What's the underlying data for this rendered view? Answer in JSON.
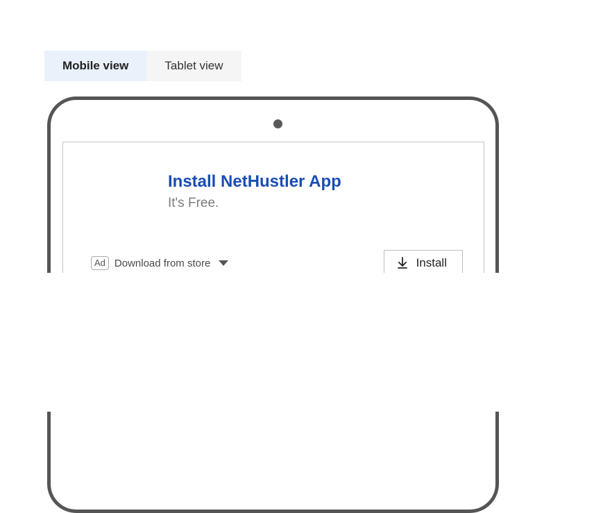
{
  "tabs": {
    "mobile": "Mobile view",
    "tablet": "Tablet view"
  },
  "ad": {
    "headline": "Install NetHustler App",
    "subline": "It's Free.",
    "badge": "Ad",
    "source": "Download from store",
    "install_label": "Install"
  }
}
